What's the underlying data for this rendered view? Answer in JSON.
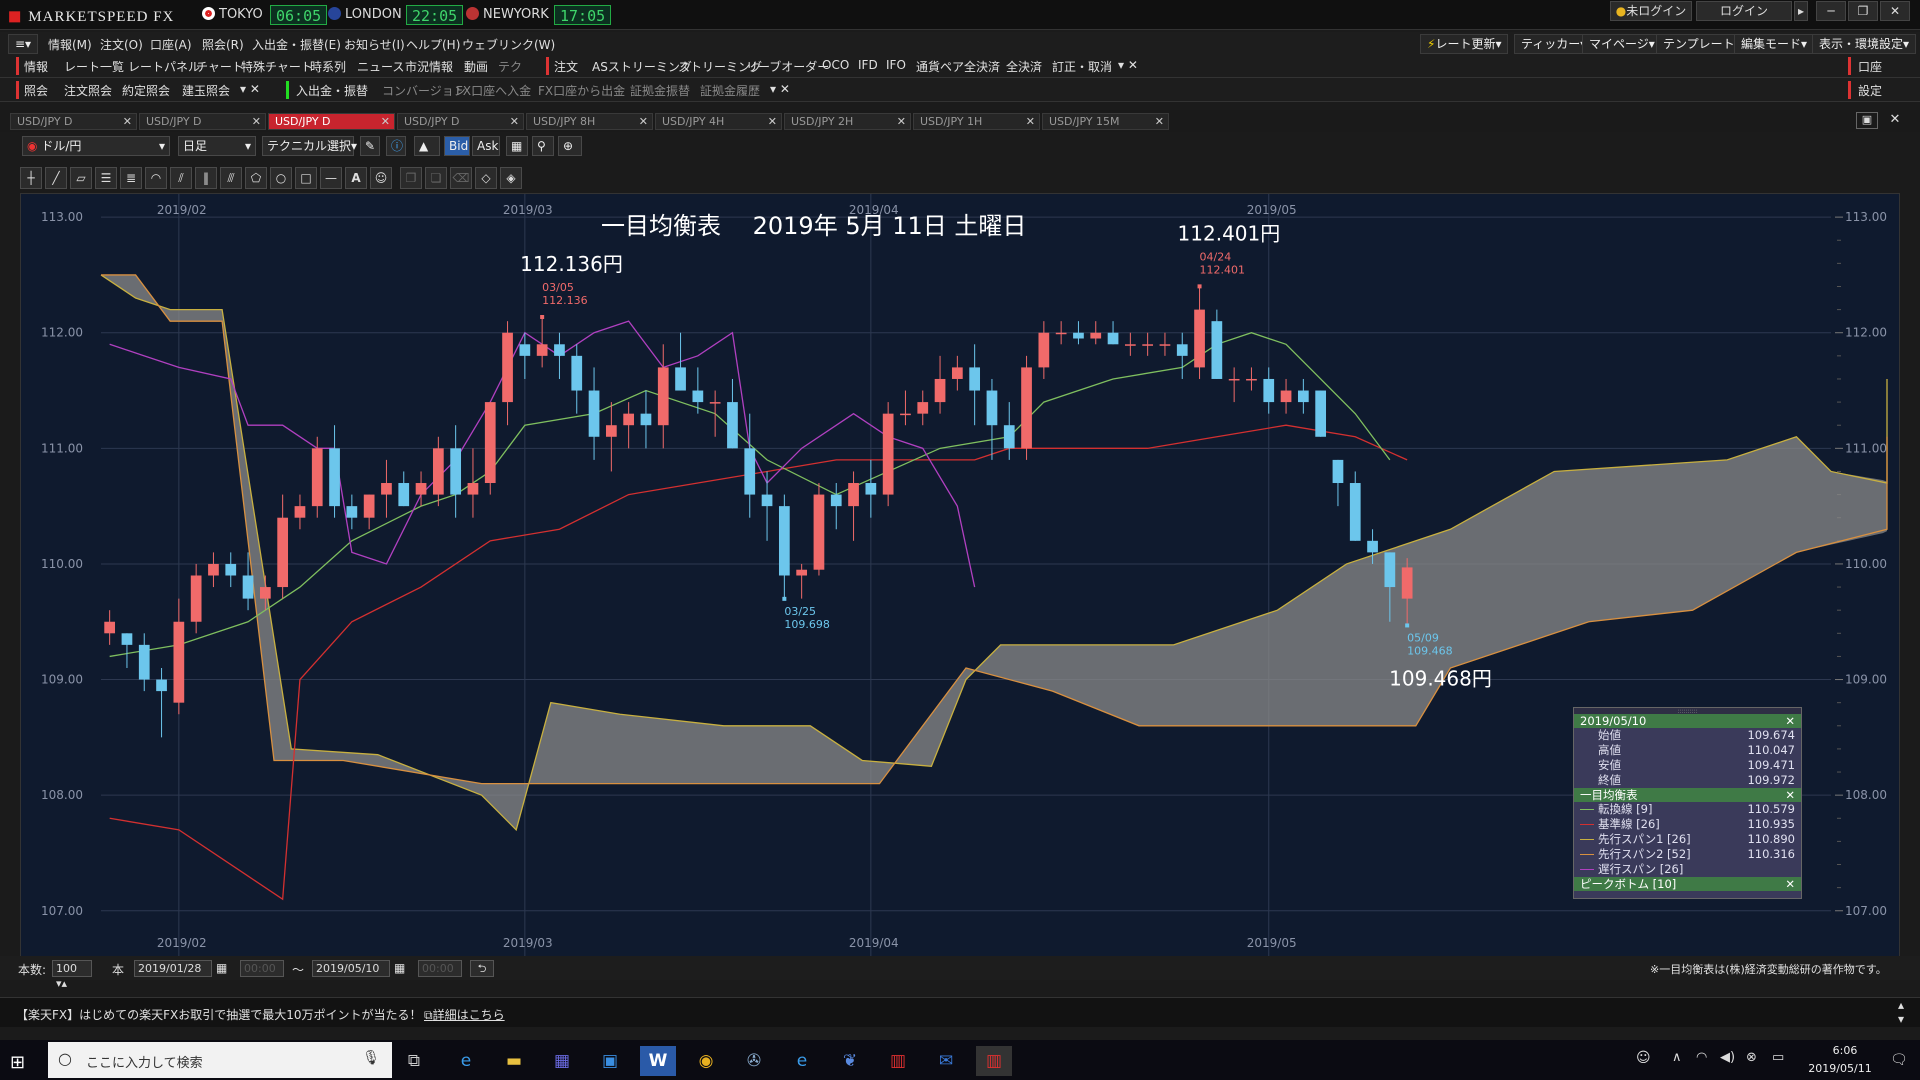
{
  "app": {
    "title": "MARKETSPEED FX",
    "cities": [
      {
        "name": "TOKYO",
        "time": "06:05"
      },
      {
        "name": "LONDON",
        "time": "22:05"
      },
      {
        "name": "NEWYORK",
        "time": "17:05"
      }
    ],
    "login_status": "未ログイン",
    "login_btn": "ログイン"
  },
  "menu": [
    "情報(M)",
    "注文(O)",
    "口座(A)",
    "照会(R)",
    "入出金・振替(E)",
    "お知らせ(I)",
    "ヘルプ(H)",
    "ウェブリンク(W)"
  ],
  "top_right": [
    "レート更新",
    "ティッカー",
    "マイページ",
    "テンプレート",
    "編集モード",
    "表示・環境設定"
  ],
  "toolbar1": {
    "label": "情報",
    "items": [
      "レート一覧",
      "レートパネル",
      "チャート",
      "特殊チャート",
      "時系列",
      "ニュース",
      "市況情報",
      "動画",
      "テク"
    ],
    "order_label": "注文",
    "order_items": [
      "ASストリーミング",
      "ストリーミング",
      "リーブオーダー",
      "OCO",
      "IFD",
      "IFO",
      "通貨ペア全決済",
      "全決済",
      "訂正・取消"
    ],
    "right": "口座"
  },
  "toolbar2": {
    "label": "照会",
    "items": [
      "注文照会",
      "約定照会",
      "建玉照会"
    ],
    "deposit": "入出金・振替",
    "more": [
      "コンバージョン",
      "FX口座へ入金",
      "FX口座から出金",
      "証拠金振替",
      "証拠金履歴"
    ],
    "right": "設定"
  },
  "tabs": [
    "USD/JPY D",
    "USD/JPY D",
    "USD/JPY D",
    "USD/JPY D",
    "USD/JPY 8H",
    "USD/JPY 4H",
    "USD/JPY 2H",
    "USD/JPY 1H",
    "USD/JPY 15M"
  ],
  "controls": {
    "pair": "ドル/円",
    "period": "日足",
    "tech": "テクニカル選択",
    "bid": "Bid",
    "ask": "Ask"
  },
  "bottom": {
    "count_label": "本数:",
    "count": "100",
    "unit": "本",
    "from": "2019/01/28",
    "to": "2019/05/10",
    "copyright": "※一目均衡表は(株)経済変動総研の著作物です。"
  },
  "news": "【楽天FX】はじめての楽天FXお取引で抽選で最大10万ポイントが当たる！",
  "news_link": "詳細はこちら",
  "taskbar": {
    "search": "ここに入力して検索",
    "time": "6:06",
    "date": "2019/05/11"
  },
  "info_box": {
    "date": "2019/05/10",
    "ohlc": [
      {
        "label": "始値",
        "value": "109.674"
      },
      {
        "label": "高値",
        "value": "110.047"
      },
      {
        "label": "安値",
        "value": "109.471"
      },
      {
        "label": "終値",
        "value": "109.972"
      }
    ],
    "ichimoku_header": "一目均衡表",
    "lines": [
      {
        "label": "転換線 [9]",
        "value": "110.579",
        "color": "#7fbf5f"
      },
      {
        "label": "基準線 [26]",
        "value": "110.935",
        "color": "#d33030"
      },
      {
        "label": "先行スパン1 [26]",
        "value": "110.890",
        "color": "#c8b040"
      },
      {
        "label": "先行スパン2 [52]",
        "value": "110.316",
        "color": "#d89040"
      },
      {
        "label": "遅行スパン [26]",
        "value": "",
        "color": "#b040c0"
      }
    ],
    "peak_header": "ピークボトム [10]"
  },
  "chart_data": {
    "type": "candlestick",
    "title": "一目均衡表　 2019年 5月 11日 土曜日",
    "ylim": [
      106.6,
      113.2
    ],
    "yticks": [
      107,
      108,
      109,
      110,
      111,
      112,
      113
    ],
    "ytick_labels": [
      "107.00",
      "108.00",
      "109.00",
      "110.00",
      "111.00",
      "112.00",
      "113.00"
    ],
    "xlabels": [
      {
        "label": "2019/02",
        "i": 4
      },
      {
        "label": "2019/03",
        "i": 24
      },
      {
        "label": "2019/04",
        "i": 44
      },
      {
        "label": "2019/05",
        "i": 67
      }
    ],
    "nbars": 100,
    "candles": [
      [
        0,
        109.4,
        109.6,
        109.3,
        109.5
      ],
      [
        1,
        109.4,
        109.4,
        109.1,
        109.3
      ],
      [
        2,
        109.3,
        109.4,
        108.9,
        109.0
      ],
      [
        3,
        109.0,
        109.1,
        108.5,
        108.9
      ],
      [
        4,
        108.8,
        109.7,
        108.7,
        109.5
      ],
      [
        5,
        109.5,
        110.0,
        109.4,
        109.9
      ],
      [
        6,
        109.9,
        110.1,
        109.8,
        110.0
      ],
      [
        7,
        110.0,
        110.1,
        109.8,
        109.9
      ],
      [
        8,
        109.9,
        110.1,
        109.6,
        109.7
      ],
      [
        9,
        109.7,
        109.9,
        109.6,
        109.8
      ],
      [
        10,
        109.8,
        110.6,
        109.7,
        110.4
      ],
      [
        11,
        110.4,
        110.6,
        110.3,
        110.5
      ],
      [
        12,
        110.5,
        111.1,
        110.4,
        111.0
      ],
      [
        13,
        111.0,
        111.2,
        110.4,
        110.5
      ],
      [
        14,
        110.5,
        110.6,
        110.3,
        110.4
      ],
      [
        15,
        110.4,
        110.6,
        110.3,
        110.6
      ],
      [
        16,
        110.6,
        110.9,
        110.4,
        110.7
      ],
      [
        17,
        110.7,
        110.8,
        110.5,
        110.5
      ],
      [
        18,
        110.6,
        110.8,
        110.5,
        110.7
      ],
      [
        19,
        110.6,
        111.1,
        110.5,
        111.0
      ],
      [
        20,
        111.0,
        111.2,
        110.4,
        110.6
      ],
      [
        21,
        110.6,
        111.0,
        110.4,
        110.7
      ],
      [
        22,
        110.7,
        111.4,
        110.6,
        111.4
      ],
      [
        23,
        111.4,
        112.1,
        111.2,
        112.0
      ],
      [
        24,
        111.9,
        112.0,
        111.6,
        111.8
      ],
      [
        25,
        111.8,
        112.14,
        111.7,
        111.9
      ],
      [
        26,
        111.9,
        112.0,
        111.6,
        111.8
      ],
      [
        27,
        111.8,
        111.9,
        111.3,
        111.5
      ],
      [
        28,
        111.5,
        111.7,
        110.9,
        111.1
      ],
      [
        29,
        111.1,
        111.4,
        110.8,
        111.2
      ],
      [
        30,
        111.2,
        111.4,
        111.0,
        111.3
      ],
      [
        31,
        111.3,
        111.5,
        111.0,
        111.2
      ],
      [
        32,
        111.2,
        111.9,
        111.0,
        111.7
      ],
      [
        33,
        111.7,
        112.0,
        111.5,
        111.5
      ],
      [
        34,
        111.5,
        111.7,
        111.3,
        111.4
      ],
      [
        35,
        111.4,
        111.5,
        111.1,
        111.4
      ],
      [
        36,
        111.4,
        111.6,
        111.0,
        111.0
      ],
      [
        37,
        111.0,
        111.3,
        110.4,
        110.6
      ],
      [
        38,
        110.6,
        110.8,
        110.2,
        110.5
      ],
      [
        39,
        110.5,
        110.6,
        109.7,
        109.9
      ],
      [
        40,
        109.9,
        110.0,
        109.7,
        109.95
      ],
      [
        41,
        109.95,
        110.7,
        109.9,
        110.6
      ],
      [
        42,
        110.6,
        110.7,
        110.3,
        110.5
      ],
      [
        43,
        110.5,
        110.8,
        110.2,
        110.7
      ],
      [
        44,
        110.7,
        110.9,
        110.4,
        110.6
      ],
      [
        45,
        110.6,
        111.4,
        110.5,
        111.3
      ],
      [
        46,
        111.3,
        111.5,
        111.2,
        111.3
      ],
      [
        47,
        111.3,
        111.5,
        111.2,
        111.4
      ],
      [
        48,
        111.4,
        111.8,
        111.3,
        111.6
      ],
      [
        49,
        111.6,
        111.8,
        111.5,
        111.7
      ],
      [
        50,
        111.7,
        111.9,
        111.2,
        111.5
      ],
      [
        51,
        111.5,
        111.6,
        110.9,
        111.2
      ],
      [
        52,
        111.2,
        111.4,
        110.9,
        111.0
      ],
      [
        53,
        111.0,
        111.8,
        110.9,
        111.7
      ],
      [
        54,
        111.7,
        112.1,
        111.6,
        112.0
      ],
      [
        55,
        112.0,
        112.1,
        111.9,
        112.0
      ],
      [
        56,
        112.0,
        112.1,
        111.9,
        111.95
      ],
      [
        57,
        111.95,
        112.1,
        111.9,
        112.0
      ],
      [
        58,
        112.0,
        112.1,
        111.9,
        111.9
      ],
      [
        59,
        111.9,
        112.0,
        111.8,
        111.9
      ],
      [
        60,
        111.9,
        112.0,
        111.8,
        111.9
      ],
      [
        61,
        111.9,
        112.0,
        111.8,
        111.9
      ],
      [
        62,
        111.9,
        112.0,
        111.6,
        111.8
      ],
      [
        63,
        111.7,
        112.4,
        111.6,
        112.2
      ],
      [
        64,
        112.1,
        112.2,
        111.6,
        111.6
      ],
      [
        65,
        111.6,
        111.7,
        111.4,
        111.6
      ],
      [
        66,
        111.6,
        111.7,
        111.5,
        111.6
      ],
      [
        67,
        111.6,
        111.7,
        111.3,
        111.4
      ],
      [
        68,
        111.4,
        111.6,
        111.3,
        111.5
      ],
      [
        69,
        111.5,
        111.6,
        111.3,
        111.4
      ],
      [
        70,
        111.5,
        111.5,
        111.1,
        111.1
      ],
      [
        71,
        110.9,
        110.9,
        110.5,
        110.7
      ],
      [
        72,
        110.7,
        110.8,
        110.2,
        110.2
      ],
      [
        73,
        110.2,
        110.3,
        110.0,
        110.1
      ],
      [
        74,
        110.1,
        110.1,
        109.5,
        109.8
      ],
      [
        75,
        109.7,
        110.05,
        109.47,
        109.97
      ]
    ],
    "senkou_span1": [
      [
        0,
        112.5
      ],
      [
        2,
        112.3
      ],
      [
        4,
        112.2
      ],
      [
        7,
        112.2
      ],
      [
        11,
        108.4
      ],
      [
        16,
        108.35
      ],
      [
        22,
        108.0
      ],
      [
        24,
        107.7
      ],
      [
        26,
        108.8
      ],
      [
        30,
        108.7
      ],
      [
        36,
        108.6
      ],
      [
        41,
        108.6
      ],
      [
        44,
        108.3
      ],
      [
        48,
        108.25
      ],
      [
        50,
        109.0
      ],
      [
        52,
        109.3
      ],
      [
        62,
        109.3
      ],
      [
        68,
        109.6
      ],
      [
        72,
        110.0
      ],
      [
        78,
        110.3
      ],
      [
        84,
        110.8
      ],
      [
        94,
        110.9
      ],
      [
        98,
        111.1
      ],
      [
        100,
        110.8
      ],
      [
        104,
        110.7
      ],
      [
        116,
        110.7
      ],
      [
        120,
        111.0
      ],
      [
        125,
        111.2
      ],
      [
        130,
        111.6
      ],
      [
        136,
        111.5
      ],
      [
        140,
        111.6
      ],
      [
        143,
        111.5
      ],
      [
        145,
        111.1
      ],
      [
        149,
        110.9
      ],
      [
        152,
        110.85
      ]
    ],
    "senkou_span2": [
      [
        0,
        112.5
      ],
      [
        2,
        112.5
      ],
      [
        4,
        112.1
      ],
      [
        7,
        112.1
      ],
      [
        10,
        108.3
      ],
      [
        14,
        108.3
      ],
      [
        22,
        108.1
      ],
      [
        26,
        108.1
      ],
      [
        30,
        108.1
      ],
      [
        40,
        108.1
      ],
      [
        45,
        108.1
      ],
      [
        50,
        109.1
      ],
      [
        55,
        108.9
      ],
      [
        60,
        108.6
      ],
      [
        64,
        108.6
      ],
      [
        68,
        108.6
      ],
      [
        72,
        108.6
      ],
      [
        76,
        108.6
      ],
      [
        78,
        109.1
      ],
      [
        82,
        109.3
      ],
      [
        86,
        109.5
      ],
      [
        92,
        109.6
      ],
      [
        98,
        110.1
      ],
      [
        104,
        110.3
      ],
      [
        108,
        110.3
      ],
      [
        112,
        110.5
      ],
      [
        116,
        110.6
      ],
      [
        120,
        110.8
      ],
      [
        124,
        110.9
      ],
      [
        130,
        111.0
      ],
      [
        136,
        111.0
      ],
      [
        140,
        111.05
      ],
      [
        145,
        111.1
      ],
      [
        149,
        111.1
      ],
      [
        152,
        111.1
      ]
    ],
    "tenkan": [
      [
        0,
        109.2
      ],
      [
        4,
        109.3
      ],
      [
        8,
        109.5
      ],
      [
        11,
        109.8
      ],
      [
        14,
        110.2
      ],
      [
        18,
        110.5
      ],
      [
        20,
        110.6
      ],
      [
        22,
        110.8
      ],
      [
        24,
        111.2
      ],
      [
        28,
        111.3
      ],
      [
        31,
        111.5
      ],
      [
        35,
        111.3
      ],
      [
        38,
        110.9
      ],
      [
        42,
        110.6
      ],
      [
        45,
        110.8
      ],
      [
        48,
        111.0
      ],
      [
        52,
        111.1
      ],
      [
        54,
        111.4
      ],
      [
        58,
        111.6
      ],
      [
        62,
        111.7
      ],
      [
        64,
        111.9
      ],
      [
        66,
        112.0
      ],
      [
        68,
        111.9
      ],
      [
        70,
        111.6
      ],
      [
        72,
        111.3
      ],
      [
        74,
        110.9
      ]
    ],
    "kijun": [
      [
        0,
        107.8
      ],
      [
        4,
        107.7
      ],
      [
        8,
        107.3
      ],
      [
        10,
        107.1
      ],
      [
        11,
        109.0
      ],
      [
        14,
        109.5
      ],
      [
        18,
        109.8
      ],
      [
        22,
        110.2
      ],
      [
        26,
        110.3
      ],
      [
        30,
        110.6
      ],
      [
        34,
        110.7
      ],
      [
        38,
        110.8
      ],
      [
        42,
        110.9
      ],
      [
        46,
        110.9
      ],
      [
        50,
        110.9
      ],
      [
        52,
        111.0
      ],
      [
        56,
        111.0
      ],
      [
        60,
        111.0
      ],
      [
        64,
        111.1
      ],
      [
        68,
        111.2
      ],
      [
        72,
        111.1
      ],
      [
        75,
        110.9
      ]
    ],
    "chikou": [
      [
        0,
        111.9
      ],
      [
        2,
        111.8
      ],
      [
        4,
        111.7
      ],
      [
        7,
        111.6
      ],
      [
        8,
        111.2
      ],
      [
        10,
        111.2
      ],
      [
        12,
        111.0
      ],
      [
        13,
        111.0
      ],
      [
        14,
        110.1
      ],
      [
        16,
        110.0
      ],
      [
        18,
        110.6
      ],
      [
        20,
        110.9
      ],
      [
        22,
        111.4
      ],
      [
        24,
        112.0
      ],
      [
        26,
        111.8
      ],
      [
        28,
        112.0
      ],
      [
        30,
        112.1
      ],
      [
        32,
        111.7
      ],
      [
        34,
        111.8
      ],
      [
        36,
        112.0
      ],
      [
        37,
        111.0
      ],
      [
        38,
        110.7
      ],
      [
        40,
        111.0
      ],
      [
        43,
        111.3
      ],
      [
        45,
        111.1
      ],
      [
        47,
        111.0
      ],
      [
        49,
        110.5
      ],
      [
        50,
        109.8
      ]
    ],
    "annotations": [
      {
        "i": 25,
        "price": 112.136,
        "date": "03/05",
        "val": "112.136",
        "big": "112.136円",
        "pos": "high"
      },
      {
        "i": 63,
        "price": 112.401,
        "date": "04/24",
        "val": "112.401",
        "big": "112.401円",
        "pos": "high"
      },
      {
        "i": 39,
        "price": 109.698,
        "date": "03/25",
        "val": "109.698",
        "big": "",
        "pos": "low"
      },
      {
        "i": 75,
        "price": 109.468,
        "date": "05/09",
        "val": "109.468",
        "big": "109.468円",
        "pos": "low"
      }
    ]
  }
}
